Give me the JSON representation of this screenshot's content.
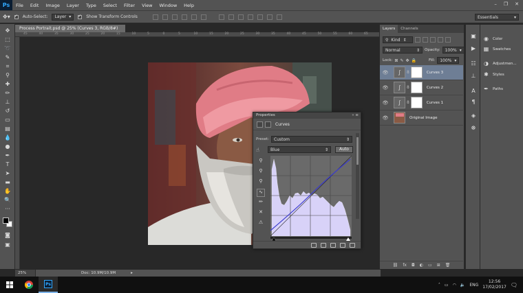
{
  "app": {
    "logo": "Ps"
  },
  "menu": [
    "File",
    "Edit",
    "Image",
    "Layer",
    "Type",
    "Select",
    "Filter",
    "View",
    "Window",
    "Help"
  ],
  "window_controls": [
    "–",
    "❐",
    "✕"
  ],
  "options_bar": {
    "auto_select_label": "Auto-Select:",
    "auto_select_target": "Layer",
    "transform_label": "Show Transform Controls",
    "workspace": "Essentials"
  },
  "document": {
    "tab_title": "Process Portrait.psd @ 25% (Curves 3, RGB/8#) *",
    "close_glyph": "×",
    "ruler_ticks": [
      "45",
      "40",
      "35",
      "30",
      "25",
      "20",
      "15",
      "10",
      "5",
      "0",
      "5",
      "10",
      "15",
      "20",
      "25",
      "30",
      "35",
      "40",
      "45",
      "50",
      "55",
      "60",
      "65"
    ]
  },
  "status_bar": {
    "zoom": "25%",
    "doc_size": "Doc: 10.9M/10.9M"
  },
  "properties": {
    "title": "Properties",
    "close_glyph": "«  ≡",
    "adjustment_type": "Curves",
    "preset_label": "Preset:",
    "preset_value": "Custom",
    "channel_value": "Blue",
    "auto_button": "Auto"
  },
  "layers_panel": {
    "tabs": [
      "Layers",
      "Channels"
    ],
    "kind_label": "Kind",
    "blend_mode": "Normal",
    "opacity_label": "Opacity:",
    "opacity_value": "100%",
    "lock_label": "Lock:",
    "fill_label": "Fill:",
    "fill_value": "100%",
    "layers": [
      {
        "name": "Curves 3",
        "selected": true
      },
      {
        "name": "Curves 2",
        "selected": false
      },
      {
        "name": "Curves 1",
        "selected": false
      },
      {
        "name": "Original Image",
        "selected": false
      }
    ]
  },
  "right_panel": {
    "items": [
      "Color",
      "Swatches",
      "Adjustmen...",
      "Styles",
      "Paths"
    ]
  },
  "taskbar": {
    "language": "ENG",
    "time": "12:56",
    "date": "17/02/2017"
  },
  "colors": {
    "accent_selected_layer": "#6e7e95",
    "curve_line": "#3a3ad0",
    "histogram_fill": "#d8d2f8"
  }
}
